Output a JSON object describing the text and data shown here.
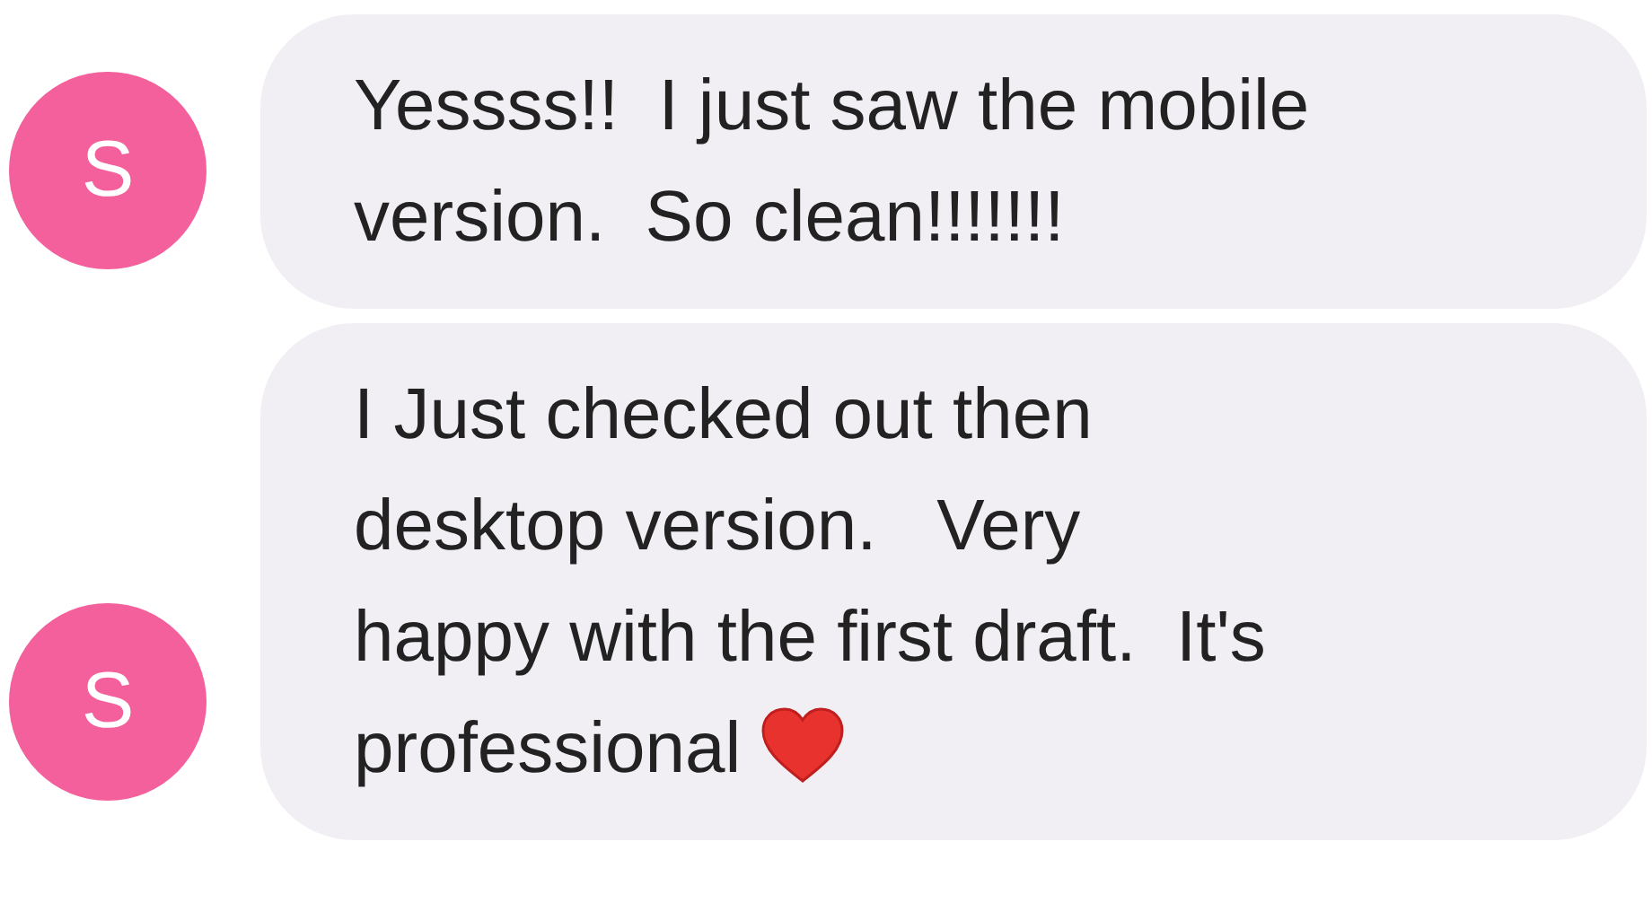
{
  "messages": [
    {
      "avatar": "S",
      "text": "Yessss!!  I just saw the mobile\nversion.  So clean!!!!!!!",
      "heart": false
    },
    {
      "avatar": "S",
      "text": "I Just checked out then\ndesktop version.   Very\nhappy with the first draft.  It's\nprofessional",
      "heart": true
    }
  ]
}
